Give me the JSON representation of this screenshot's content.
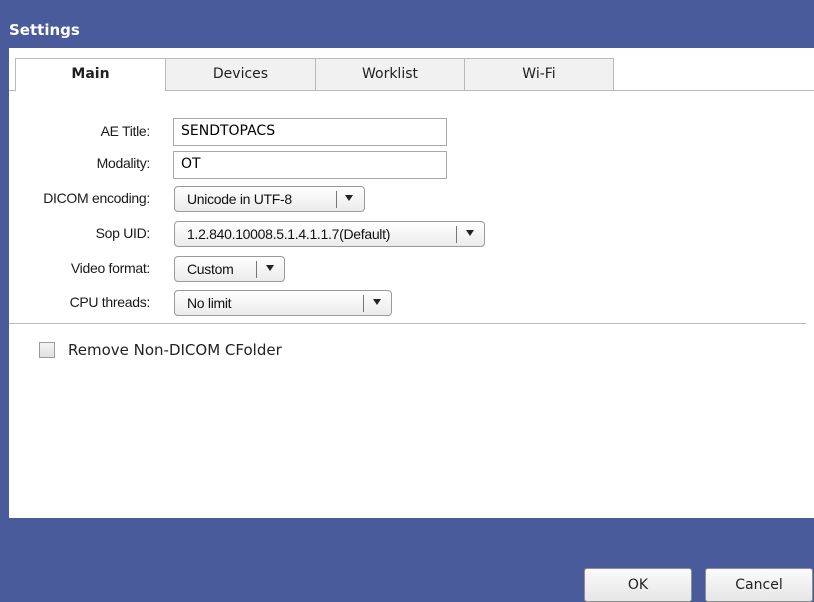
{
  "window": {
    "title": "Settings"
  },
  "tabs": [
    {
      "label": "Main"
    },
    {
      "label": "Devices"
    },
    {
      "label": "Worklist"
    },
    {
      "label": "Wi-Fi"
    }
  ],
  "form": {
    "ae_title": {
      "label": "AE Title:",
      "value": "SENDTOPACS"
    },
    "modality": {
      "label": "Modality:",
      "value": "OT"
    },
    "dicom_encoding": {
      "label": "DICOM encoding:",
      "value": "Unicode in UTF-8"
    },
    "sop_uid": {
      "label": "Sop UID:",
      "value": "1.2.840.10008.5.1.4.1.1.7(Default)"
    },
    "video_format": {
      "label": "Video format:",
      "value": "Custom"
    },
    "cpu_threads": {
      "label": "CPU threads:",
      "value": "No limit"
    }
  },
  "options": {
    "remove_non_dicom": {
      "label": "Remove Non-DICOM CFolder",
      "checked": false
    }
  },
  "buttons": {
    "ok": "OK",
    "cancel": "Cancel"
  },
  "colors": {
    "titlebar": "#4a5b9c",
    "panel": "#ffffff"
  }
}
